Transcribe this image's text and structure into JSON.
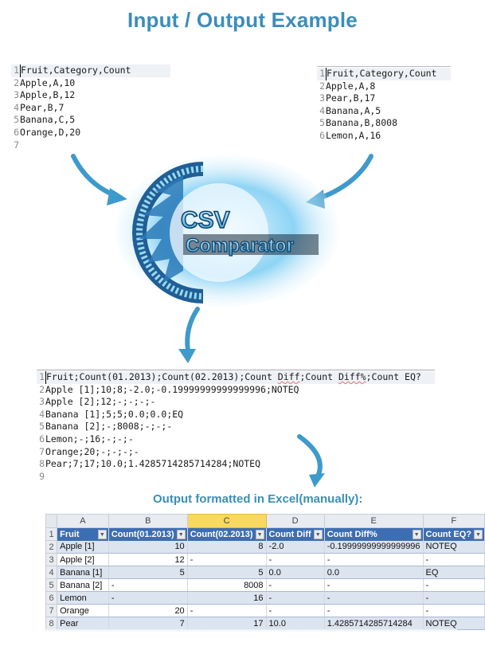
{
  "title": "Input / Output Example",
  "input_left": {
    "lines": [
      {
        "n": "1",
        "text": "Fruit,Category,Count"
      },
      {
        "n": "2",
        "text": "Apple,A,10"
      },
      {
        "n": "3",
        "text": "Apple,B,12"
      },
      {
        "n": "4",
        "text": "Pear,B,7"
      },
      {
        "n": "5",
        "text": "Banana,C,5"
      },
      {
        "n": "6",
        "text": "Orange,D,20"
      },
      {
        "n": "7",
        "text": ""
      }
    ]
  },
  "input_right": {
    "lines": [
      {
        "n": "1",
        "text": "Fruit,Category,Count"
      },
      {
        "n": "2",
        "text": "Apple,A,8"
      },
      {
        "n": "3",
        "text": "Pear,B,17"
      },
      {
        "n": "4",
        "text": "Banana,A,5"
      },
      {
        "n": "5",
        "text": "Banana,B,8008"
      },
      {
        "n": "6",
        "text": "Lemon,A,16"
      }
    ]
  },
  "logo": {
    "line1": "CSV",
    "line2": "Comparator"
  },
  "output_csv": {
    "header_parts": [
      "Fruit;Count(01.2013);Count(02.2013);Count ",
      "Diff",
      ";Count ",
      "Diff%",
      ";Count EQ?"
    ],
    "lines": [
      {
        "n": "2",
        "text": "Apple [1];10;8;-2.0;-0.19999999999999996;NOTEQ"
      },
      {
        "n": "3",
        "text": "Apple [2];12;-;-;-;-"
      },
      {
        "n": "4",
        "text": "Banana [1];5;5;0.0;0.0;EQ"
      },
      {
        "n": "5",
        "text": "Banana [2];-;8008;-;-;-"
      },
      {
        "n": "6",
        "text": "Lemon;-;16;-;-;-"
      },
      {
        "n": "7",
        "text": "Orange;20;-;-;-;-"
      },
      {
        "n": "8",
        "text": "Pear;7;17;10.0;1.4285714285714284;NOTEQ"
      },
      {
        "n": "9",
        "text": ""
      }
    ]
  },
  "excel": {
    "caption": "Output formatted in Excel(manually):",
    "column_letters": [
      "A",
      "B",
      "C",
      "D",
      "E",
      "F"
    ],
    "selected_column": "C",
    "headers": [
      "Fruit",
      "Count(01.2013)",
      "Count(02.2013)",
      "Count Diff",
      "Count Diff%",
      "Count EQ?"
    ],
    "rows": [
      {
        "rn": "2",
        "cells": [
          "Apple [1]",
          "10",
          "8",
          "-2.0",
          "-0.19999999999999996",
          "NOTEQ"
        ]
      },
      {
        "rn": "3",
        "cells": [
          "Apple [2]",
          "12",
          "-",
          "-",
          "-",
          "-"
        ]
      },
      {
        "rn": "4",
        "cells": [
          "Banana [1]",
          "5",
          "5",
          "0.0",
          "0.0",
          "EQ"
        ]
      },
      {
        "rn": "5",
        "cells": [
          "Banana [2]",
          "-",
          "8008",
          "-",
          "-",
          "-"
        ]
      },
      {
        "rn": "6",
        "cells": [
          "Lemon",
          "-",
          "16",
          "-",
          "-",
          "-"
        ]
      },
      {
        "rn": "7",
        "cells": [
          "Orange",
          "20",
          "-",
          "-",
          "-",
          "-"
        ]
      },
      {
        "rn": "8",
        "cells": [
          "Pear",
          "7",
          "17",
          "10.0",
          "1.4285714285714284",
          "NOTEQ"
        ]
      }
    ]
  },
  "colors": {
    "accent": "#3b8dbd",
    "table_header": "#3d6eb3",
    "band": "#dce4f0",
    "selected_col": "#f9d95f"
  }
}
